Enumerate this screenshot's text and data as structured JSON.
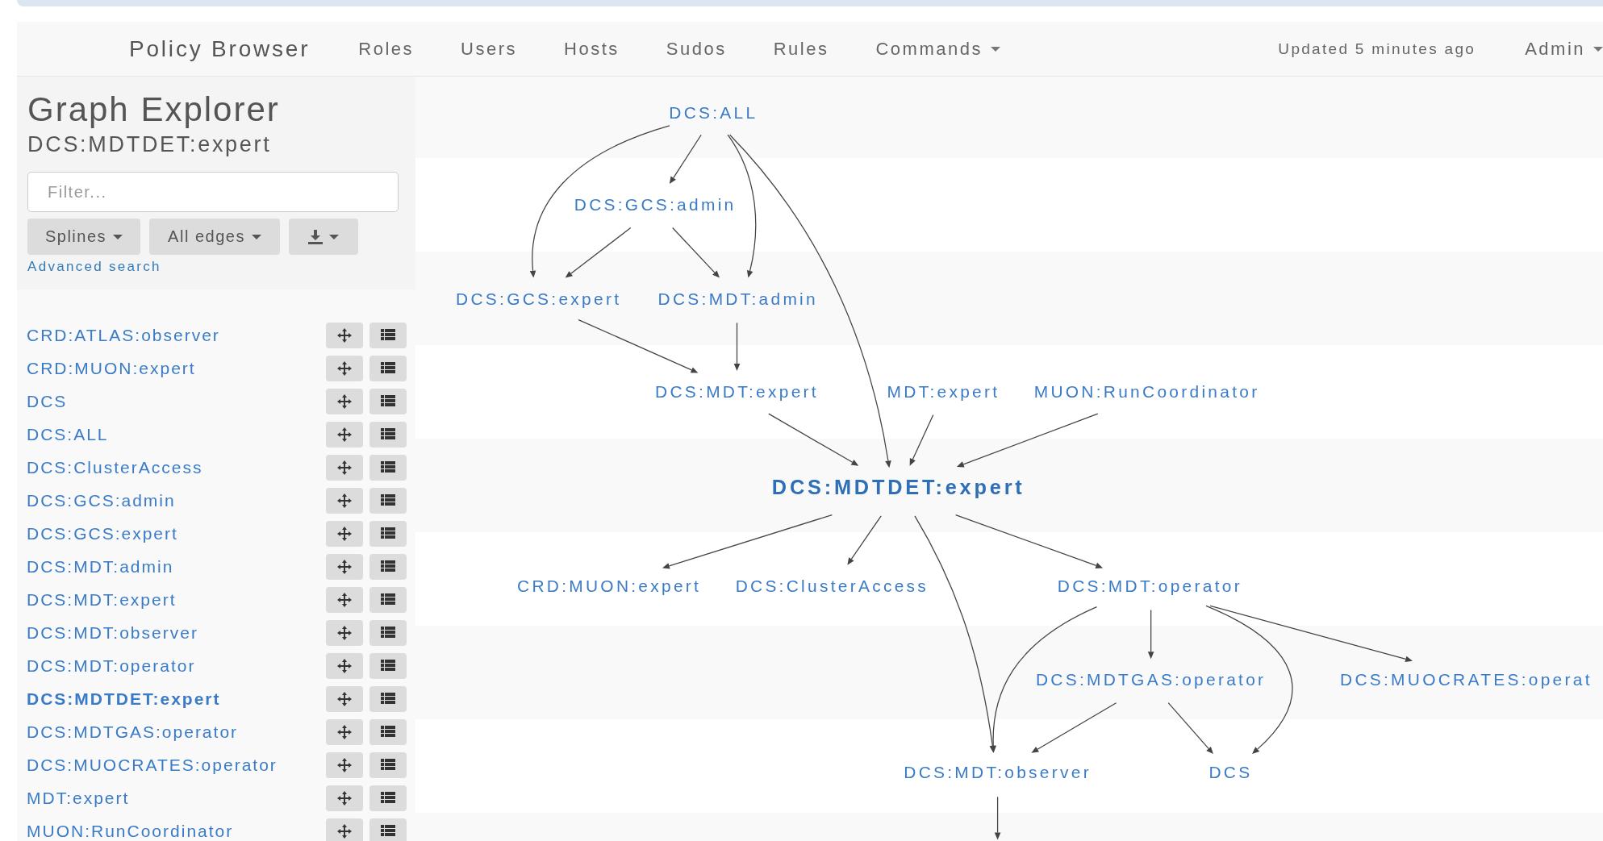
{
  "navbar": {
    "brand": "Policy Browser",
    "links": [
      {
        "label": "Roles",
        "dropdown": false
      },
      {
        "label": "Users",
        "dropdown": false
      },
      {
        "label": "Hosts",
        "dropdown": false
      },
      {
        "label": "Sudos",
        "dropdown": false
      },
      {
        "label": "Rules",
        "dropdown": false
      },
      {
        "label": "Commands",
        "dropdown": true
      }
    ],
    "status": "Updated 5 minutes ago",
    "user_menu": "Admin"
  },
  "sidebar": {
    "title": "Graph Explorer",
    "subtitle": "DCS:MDTDET:expert",
    "filter": {
      "placeholder": "Filter..."
    },
    "buttons": [
      {
        "kind": "text",
        "label": "Splines"
      },
      {
        "kind": "text",
        "label": "All edges"
      },
      {
        "kind": "download"
      }
    ],
    "advanced_link": "Advanced search",
    "roles": [
      {
        "label": "CRD:ATLAS:observer",
        "selected": false
      },
      {
        "label": "CRD:MUON:expert",
        "selected": false
      },
      {
        "label": "DCS",
        "selected": false
      },
      {
        "label": "DCS:ALL",
        "selected": false
      },
      {
        "label": "DCS:ClusterAccess",
        "selected": false
      },
      {
        "label": "DCS:GCS:admin",
        "selected": false
      },
      {
        "label": "DCS:GCS:expert",
        "selected": false
      },
      {
        "label": "DCS:MDT:admin",
        "selected": false
      },
      {
        "label": "DCS:MDT:expert",
        "selected": false
      },
      {
        "label": "DCS:MDT:observer",
        "selected": false
      },
      {
        "label": "DCS:MDT:operator",
        "selected": false
      },
      {
        "label": "DCS:MDTDET:expert",
        "selected": true
      },
      {
        "label": "DCS:MDTGAS:operator",
        "selected": false
      },
      {
        "label": "DCS:MUOCRATES:operator",
        "selected": false
      },
      {
        "label": "MDT:expert",
        "selected": false
      },
      {
        "label": "MUON:RunCoordinator",
        "selected": false
      }
    ]
  },
  "graph": {
    "nodes": [
      {
        "label": "DCS:ALL",
        "selected": false
      },
      {
        "label": "DCS:GCS:admin",
        "selected": false
      },
      {
        "label": "DCS:GCS:expert",
        "selected": false
      },
      {
        "label": "DCS:MDT:admin",
        "selected": false
      },
      {
        "label": "DCS:MDT:expert",
        "selected": false
      },
      {
        "label": "MDT:expert",
        "selected": false
      },
      {
        "label": "MUON:RunCoordinator",
        "selected": false
      },
      {
        "label": "DCS:MDTDET:expert",
        "selected": true
      },
      {
        "label": "CRD:MUON:expert",
        "selected": false
      },
      {
        "label": "DCS:ClusterAccess",
        "selected": false
      },
      {
        "label": "DCS:MDT:operator",
        "selected": false
      },
      {
        "label": "DCS:MDTGAS:operator",
        "selected": false
      },
      {
        "label": "DCS:MUOCRATES:operat",
        "selected": false
      },
      {
        "label": "DCS:MDT:observer",
        "selected": false
      },
      {
        "label": "DCS",
        "selected": false
      }
    ]
  }
}
